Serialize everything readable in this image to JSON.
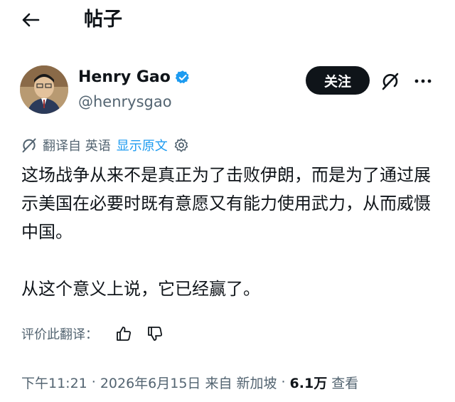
{
  "header": {
    "title": "帖子"
  },
  "author": {
    "display_name": "Henry Gao",
    "handle": "@henrysgao",
    "follow_label": "关注"
  },
  "translation": {
    "source_label": "翻译自 英语",
    "show_original_label": "显示原文"
  },
  "tweet": {
    "paragraphs": [
      "这场战争从来不是真正为了击败伊朗，而是为了通过展示美国在必要时既有意愿又有能力使用武力，从而威慑中国。",
      "从这个意义上说，它已经赢了。"
    ]
  },
  "rating": {
    "label": "评价此翻译："
  },
  "meta": {
    "time": "下午11:21",
    "date": "2026年6月15日",
    "location": "来自 新加坡",
    "views_count": "6.1万",
    "views_label": "查看",
    "separator": "·"
  },
  "colors": {
    "text_primary": "#0f1419",
    "text_secondary": "#536471",
    "accent": "#1d9bf0"
  },
  "icons": [
    "back-arrow-icon",
    "verified-badge-icon",
    "grok-icon",
    "more-icon",
    "translate-icon",
    "gear-icon",
    "thumbs-up-icon",
    "thumbs-down-icon"
  ]
}
